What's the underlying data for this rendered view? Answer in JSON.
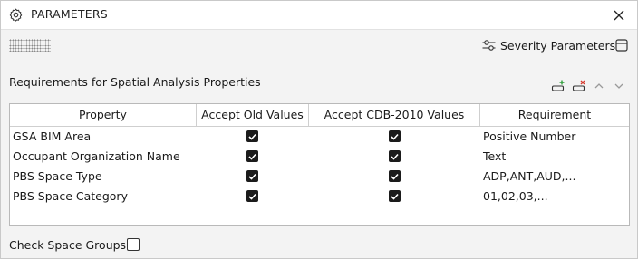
{
  "window": {
    "title": "PARAMETERS"
  },
  "toolbar": {
    "severity_label": "Severity Parameters"
  },
  "section": {
    "label": "Requirements for Spatial Analysis Properties"
  },
  "table": {
    "columns": [
      "Property",
      "Accept Old Values",
      "Accept CDB-2010 Values",
      "Requirement"
    ],
    "rows": [
      {
        "property": "GSA BIM Area",
        "accept_old": true,
        "accept_cdb": true,
        "requirement": "Positive Number"
      },
      {
        "property": "Occupant Organization Name",
        "accept_old": true,
        "accept_cdb": true,
        "requirement": "Text"
      },
      {
        "property": "PBS Space Type",
        "accept_old": true,
        "accept_cdb": true,
        "requirement": "ADP,ANT,AUD,..."
      },
      {
        "property": "PBS Space Category",
        "accept_old": true,
        "accept_cdb": true,
        "requirement": "01,02,03,..."
      }
    ]
  },
  "footer": {
    "check_space_groups_label": "Check Space Groups",
    "check_space_groups_checked": false
  },
  "colors": {
    "add_accent": "#2e9e3a",
    "remove_accent": "#d63a2e"
  }
}
